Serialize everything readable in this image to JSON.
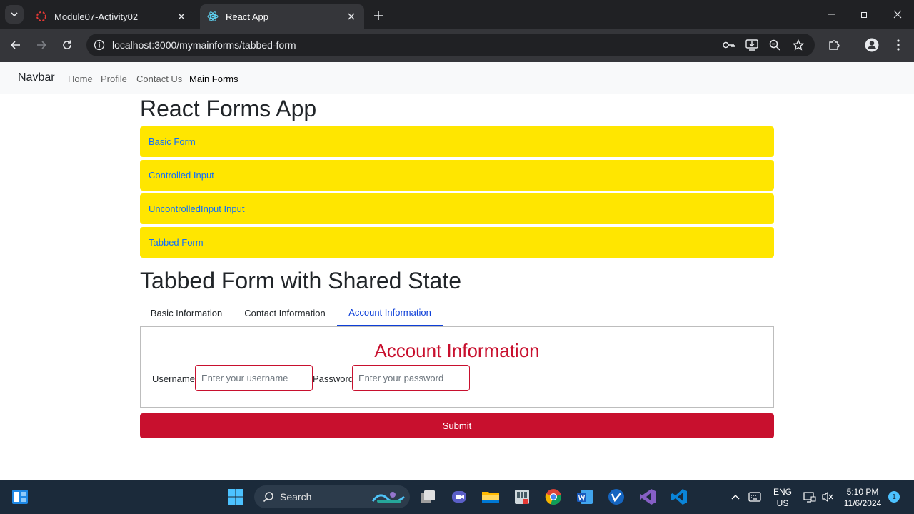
{
  "browser": {
    "tabs": [
      {
        "title": "Module07-Activity02",
        "active": false
      },
      {
        "title": "React App",
        "active": true
      }
    ],
    "url": "localhost:3000/mymainforms/tabbed-form"
  },
  "navbar": {
    "brand": "Navbar",
    "links": [
      "Home",
      "Profile",
      "Contact Us",
      "Main Forms"
    ],
    "active_link": "Main Forms"
  },
  "page": {
    "title": "React Forms App",
    "form_links": [
      "Basic Form",
      "Controlled Input",
      "UncontrolledInput Input",
      "Tabbed Form"
    ],
    "section_title": "Tabbed Form with Shared State",
    "tabs": [
      "Basic Information",
      "Contact Information",
      "Account Information"
    ],
    "active_tab": "Account Information",
    "panel": {
      "heading": "Account Information",
      "username_label": "Username:",
      "username_placeholder": "Enter your username",
      "password_label": "Password:",
      "password_placeholder": "Enter your password"
    },
    "submit_label": "Submit"
  },
  "taskbar": {
    "search_label": "Search",
    "language": "ENG",
    "region": "US",
    "time": "5:10 PM",
    "date": "11/6/2024",
    "notification_count": "1"
  },
  "colors": {
    "link_bar": "#ffe600",
    "accent_red": "#c8102e",
    "link_blue": "#0d6efd"
  }
}
